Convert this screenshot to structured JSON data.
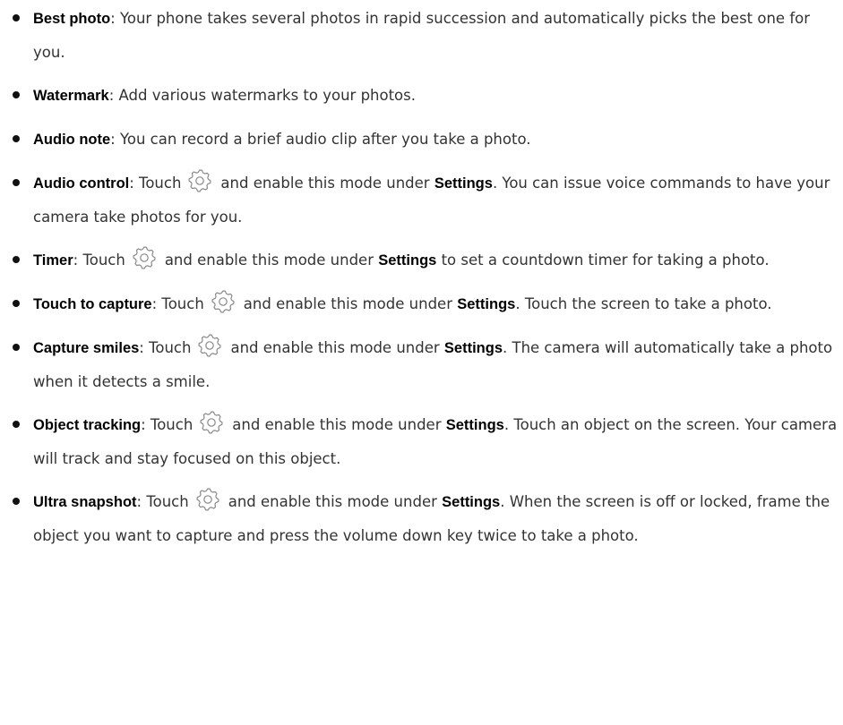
{
  "items": [
    {
      "term": "Best photo",
      "sep": ": ",
      "text": "Your phone takes several photos in rapid succession and automatically picks the best one for you."
    },
    {
      "term": "Watermark",
      "sep": ": ",
      "text": "Add various watermarks to your photos."
    },
    {
      "term": "Audio note",
      "sep": ": ",
      "text": "You can record a brief audio clip after you take a photo."
    },
    {
      "term": "Audio control",
      "pre": ": Touch",
      "mid": "and enable this mode under",
      "settings": "Settings",
      "post": ". You can issue voice commands to have your camera take photos for you."
    },
    {
      "term": "Timer",
      "pre": ": Touch",
      "mid": "and enable this mode under",
      "settings": "Settings",
      "post": " to set a countdown timer for taking a photo."
    },
    {
      "term": "Touch to capture",
      "pre": ": Touch",
      "mid": "and enable this mode under",
      "settings": "Settings",
      "post": ". Touch the screen to take a photo."
    },
    {
      "term": "Capture smiles",
      "pre": ": Touch",
      "mid": "and enable this mode under",
      "settings": "Settings",
      "post": ". The camera will automatically take a photo when it detects a smile."
    },
    {
      "term": "Object tracking",
      "pre": ": Touch",
      "mid": "and enable this mode under",
      "settings": "Settings",
      "post": ". Touch an object on the screen. Your camera will track and stay focused on this object."
    },
    {
      "term": "Ultra snapshot",
      "pre": ": Touch",
      "mid": "and enable this mode under",
      "settings": "Settings",
      "post": ". When the screen is off or locked, frame the object you want to capture and press the volume down key twice to take a photo."
    }
  ],
  "icons": {
    "settings": "gear-icon"
  },
  "colors": {
    "text": "#333333",
    "term": "#000000",
    "icon_stroke": "#8a8a8a"
  }
}
